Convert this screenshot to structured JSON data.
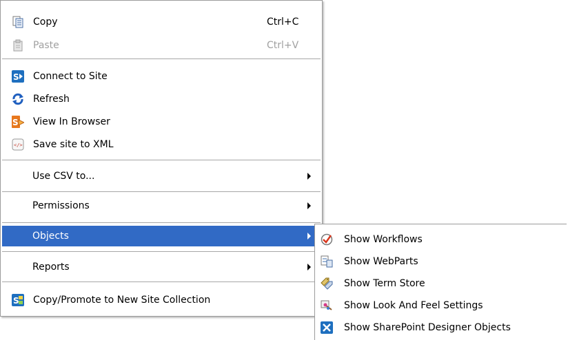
{
  "main_menu": {
    "items": [
      {
        "label": "Copy",
        "accel": "Ctrl+C",
        "icon": "copy-icon"
      },
      {
        "label": "Paste",
        "accel": "Ctrl+V",
        "icon": "paste-icon",
        "disabled": true
      },
      {
        "label": "Connect to Site",
        "icon": "sharepoint-connect-icon"
      },
      {
        "label": "Refresh",
        "icon": "refresh-icon"
      },
      {
        "label": "View In Browser",
        "icon": "browser-icon"
      },
      {
        "label": "Save site to XML",
        "icon": "xml-icon"
      },
      {
        "label": "Use CSV to...",
        "submenu": true
      },
      {
        "label": "Permissions",
        "submenu": true
      },
      {
        "label": "Objects",
        "submenu": true,
        "highlighted": true
      },
      {
        "label": "Reports",
        "submenu": true
      },
      {
        "label": "Copy/Promote to New Site Collection",
        "icon": "sharepoint-copy-icon"
      }
    ]
  },
  "objects_submenu": {
    "items": [
      {
        "label": "Show Workflows",
        "icon": "workflow-icon"
      },
      {
        "label": "Show WebParts",
        "icon": "webparts-icon"
      },
      {
        "label": "Show Term Store",
        "icon": "term-store-icon"
      },
      {
        "label": "Show Look And Feel Settings",
        "icon": "look-and-feel-icon"
      },
      {
        "label": "Show SharePoint Designer Objects",
        "icon": "sharepoint-designer-icon"
      }
    ]
  },
  "colors": {
    "highlight": "#316ac5",
    "disabled_text": "#a0a0a0",
    "separator": "#a6a6a6",
    "border": "#9b9b9b"
  }
}
